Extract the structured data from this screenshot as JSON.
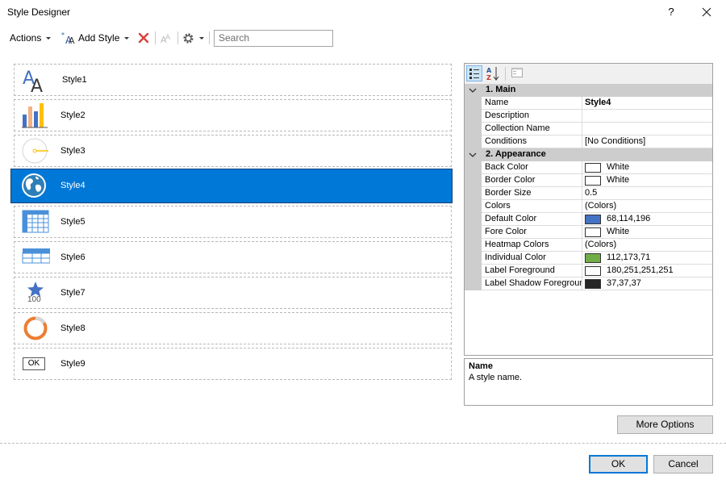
{
  "window": {
    "title": "Style Designer",
    "help_label": "?"
  },
  "toolbar": {
    "actions_label": "Actions",
    "add_style_label": "Add Style",
    "search_placeholder": "Search"
  },
  "styles": [
    {
      "label": "Style1",
      "icon": "font-aa-icon"
    },
    {
      "label": "Style2",
      "icon": "bar-chart-icon"
    },
    {
      "label": "Style3",
      "icon": "gauge-icon"
    },
    {
      "label": "Style4",
      "icon": "globe-icon",
      "selected": true
    },
    {
      "label": "Style5",
      "icon": "table-grid-icon"
    },
    {
      "label": "Style6",
      "icon": "table-header-icon"
    },
    {
      "label": "Style7",
      "icon": "star-indicator-icon",
      "icon_text": "100"
    },
    {
      "label": "Style8",
      "icon": "ring-progress-icon"
    },
    {
      "label": "Style9",
      "icon": "ok-button-icon",
      "icon_text": "OK"
    }
  ],
  "property_grid": {
    "categories": [
      {
        "label": "1. Main",
        "properties": [
          {
            "name": "Name",
            "value": "Style4"
          },
          {
            "name": "Description",
            "value": ""
          },
          {
            "name": "Collection Name",
            "value": ""
          },
          {
            "name": "Conditions",
            "value": "[No Conditions]"
          }
        ]
      },
      {
        "label": "2. Appearance",
        "properties": [
          {
            "name": "Back Color",
            "value": "White",
            "color": "#ffffff"
          },
          {
            "name": "Border Color",
            "value": "White",
            "color": "#ffffff"
          },
          {
            "name": "Border Size",
            "value": "0.5"
          },
          {
            "name": "Colors",
            "value": "(Colors)"
          },
          {
            "name": "Default Color",
            "value": "68,114,196",
            "color": "#4472c4"
          },
          {
            "name": "Fore Color",
            "value": "White",
            "color": "#ffffff"
          },
          {
            "name": "Heatmap Colors",
            "value": "(Colors)"
          },
          {
            "name": "Individual Color",
            "value": "112,173,71",
            "color": "#70ad47"
          },
          {
            "name": "Label Foreground",
            "value": "180,251,251,251",
            "color": "#fbfbfb"
          },
          {
            "name": "Label Shadow Foregroun",
            "value": "37,37,37",
            "color": "#252525"
          }
        ]
      }
    ]
  },
  "description": {
    "title": "Name",
    "text": "A style name."
  },
  "buttons": {
    "more_options": "More Options",
    "ok": "OK",
    "cancel": "Cancel"
  },
  "colors": {
    "selection": "#0078d7",
    "category_bg": "#cdcdcd"
  }
}
